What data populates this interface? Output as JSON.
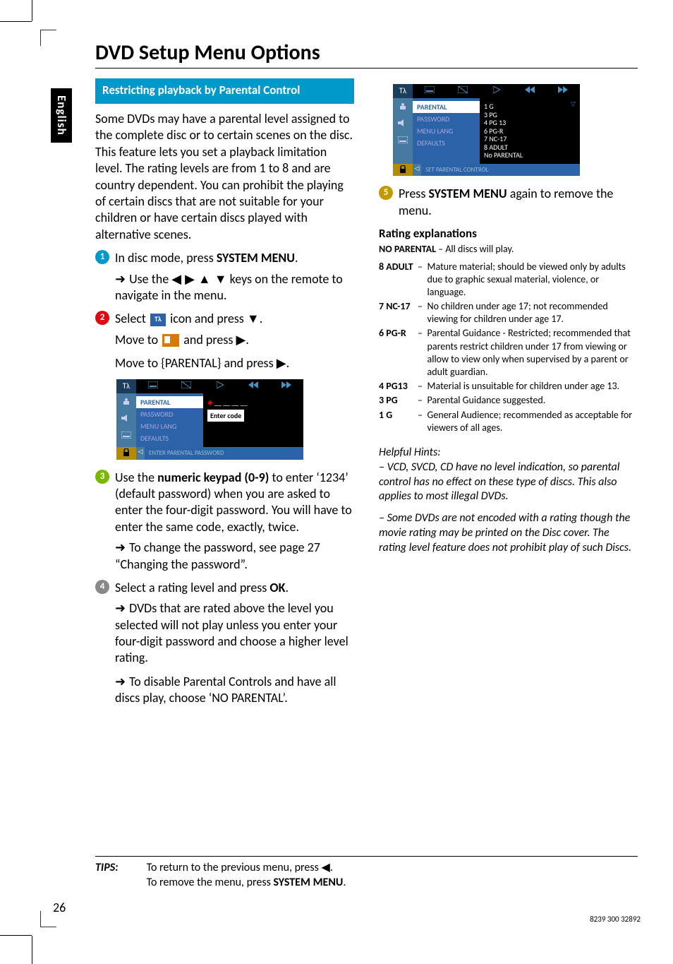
{
  "header": {
    "title": "DVD Setup Menu Options"
  },
  "side_tab": "English",
  "section": {
    "heading": "Restricting playback by Parental Control"
  },
  "intro": "Some DVDs may have a parental level assigned to the complete disc or to certain scenes on the disc.  This feature lets you set a playback limitation level. The rating levels are from 1 to 8 and are country dependent.  You can prohibit the playing of certain discs that are not suitable for your children or have certain discs played with alternative scenes.",
  "steps": {
    "s1a": "In disc mode, press ",
    "s1b": "SYSTEM MENU",
    "s1c": ".",
    "s1d": "Use the ",
    "s1e": " keys on the remote to navigate in the menu.",
    "s2a": "Select ",
    "s2b": " icon and press ",
    "s2c": ".",
    "s2d": "Move to ",
    "s2e": " and press ",
    "s2f": ".",
    "s2g": "Move to {PARENTAL} and press ",
    "s2h": ".",
    "s3a": "Use the ",
    "s3b": "numeric keypad (0-9)",
    "s3c": " to enter ‘1234’ (default password) when you are asked to enter the four-digit password. You will have to enter the same code, exactly, twice.",
    "s3d": "To change the password, see page 27 “Changing the password”.",
    "s4a": "Select a rating level and press ",
    "s4b": "OK",
    "s4c": ".",
    "s4d": "DVDs that are rated above the level you selected will not play unless you enter your four-digit password and choose a higher level rating.",
    "s4e": "To disable Parental Controls and have all discs play, choose ‘NO PARENTAL’.",
    "s5a": "Press ",
    "s5b": "SYSTEM MENU",
    "s5c": " again to remove the menu."
  },
  "ui1": {
    "menu": [
      "PARENTAL",
      "PASSWORD",
      "MENU LANG",
      "DEFAULTS"
    ],
    "value_label": "Enter code",
    "value_dashes": "__ __ __ __",
    "footer": "ENTER PARENTAL PASSWORD"
  },
  "ui2": {
    "menu": [
      "PARENTAL",
      "PASSWORD",
      "MENU LANG",
      "DEFAULTS"
    ],
    "vals": [
      "1 G",
      "3 PG",
      "4 PG 13",
      "6 PG-R",
      "7 NC-17",
      "8 ADULT",
      "No PARENTAL"
    ],
    "footer": "SET PARENTAL CONTROL"
  },
  "ratings": {
    "heading": "Rating explanations",
    "none_k": "NO PARENTAL",
    "none_v": " – All discs will play.",
    "rows": [
      {
        "k": "8 ADULT",
        "v": "Mature material; should be viewed only by adults due to graphic sexual material, violence, or language."
      },
      {
        "k": "7 NC-17",
        "v": "No children under age 17; not recommended viewing for children under age 17."
      },
      {
        "k": "6 PG-R",
        "v": "Parental Guidance - Restricted; recommended that parents restrict children under 17 from viewing or allow to view only when supervised by a parent or adult guardian."
      },
      {
        "k": "4 PG13",
        "v": "Material is unsuitable for children under age 13."
      },
      {
        "k": "3 PG",
        "v": "Parental Guidance suggested."
      },
      {
        "k": "1 G",
        "v": "General Audience; recommended as acceptable for viewers of all ages."
      }
    ]
  },
  "hints": {
    "heading": "Helpful Hints:",
    "h1": "–  VCD, SVCD, CD have no level indication, so parental control has no effect on these type of discs. This also applies to most illegal DVDs.",
    "h2": "–  Some DVDs are not encoded with a rating though the movie rating may be printed on the Disc cover.  The rating level feature does not prohibit play of such Discs."
  },
  "tips": {
    "label": "TIPS:",
    "l1a": "To return to the previous menu, press ",
    "l1b": ".",
    "l2a": "To remove the menu, press ",
    "l2b": "SYSTEM MENU",
    "l2c": "."
  },
  "page_number": "26",
  "footer_code": "8239 300 32892"
}
